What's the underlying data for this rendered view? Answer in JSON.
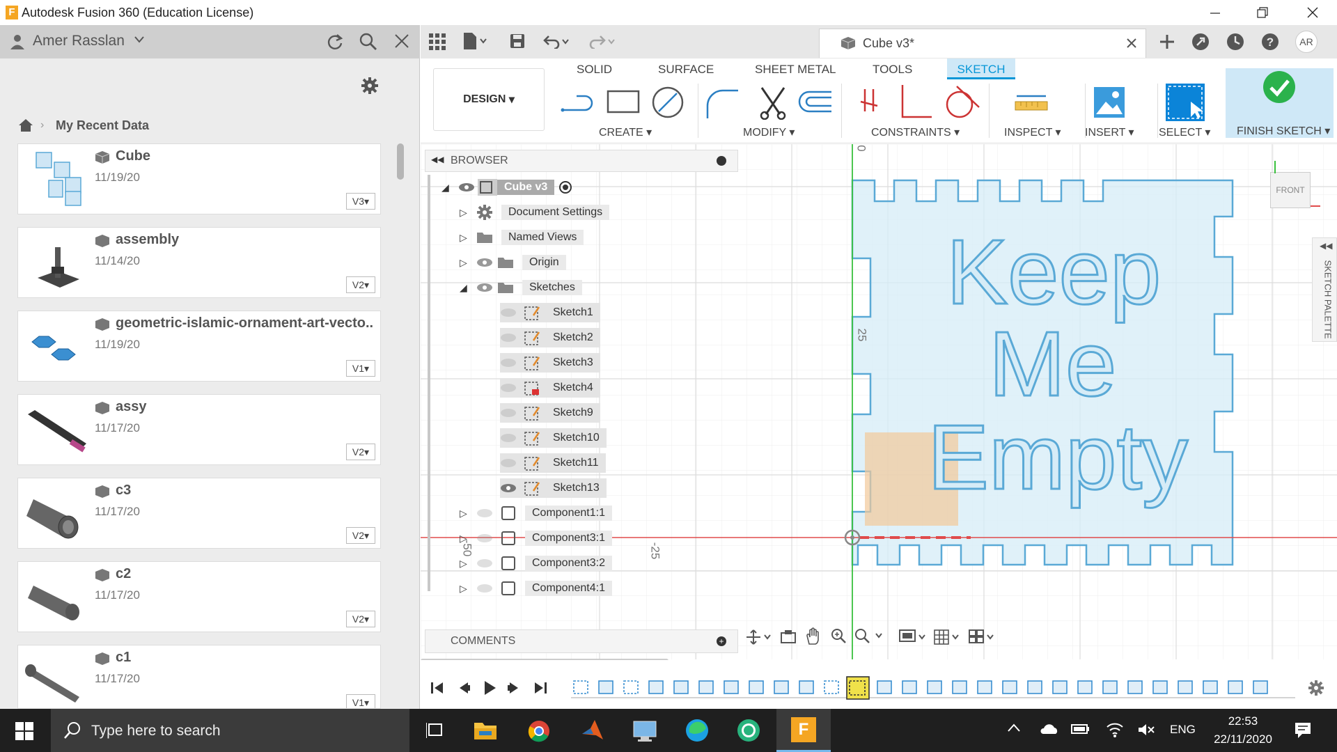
{
  "window": {
    "title": "Autodesk Fusion 360 (Education License)"
  },
  "data_panel": {
    "user": "Amer Rasslan",
    "breadcrumb": "My Recent Data",
    "items": [
      {
        "name": "Cube",
        "date": "11/19/20",
        "version": "V3"
      },
      {
        "name": "assembly",
        "date": "11/14/20",
        "version": "V2"
      },
      {
        "name": "geometric-islamic-ornament-art-vecto...",
        "date": "11/19/20",
        "version": "V1"
      },
      {
        "name": "assy",
        "date": "11/17/20",
        "version": "V2"
      },
      {
        "name": "c3",
        "date": "11/17/20",
        "version": "V2"
      },
      {
        "name": "c2",
        "date": "11/17/20",
        "version": "V2"
      },
      {
        "name": "c1",
        "date": "11/17/20",
        "version": "V1"
      }
    ]
  },
  "document": {
    "tab_title": "Cube v3*",
    "user_initials": "AR"
  },
  "toolbar": {
    "workspace": "DESIGN",
    "tabs": [
      "SOLID",
      "SURFACE",
      "SHEET METAL",
      "TOOLS",
      "SKETCH"
    ],
    "active_tab": "SKETCH",
    "groups": {
      "create": "CREATE",
      "modify": "MODIFY",
      "constraints": "CONSTRAINTS",
      "inspect": "INSPECT",
      "insert": "INSERT",
      "select": "SELECT",
      "finish": "FINISH SKETCH"
    }
  },
  "browser": {
    "title": "BROWSER",
    "root": "Cube v3",
    "nodes": [
      "Document Settings",
      "Named Views",
      "Origin",
      "Sketches"
    ],
    "sketches": [
      "Sketch1",
      "Sketch2",
      "Sketch3",
      "Sketch4",
      "Sketch9",
      "Sketch10",
      "Sketch11",
      "Sketch13"
    ],
    "components": [
      "Component1:1",
      "Component3:1",
      "Component3:2",
      "Component4:1"
    ]
  },
  "comments": {
    "title": "COMMENTS"
  },
  "canvas": {
    "text_lines": [
      "Keep",
      "Me",
      "Empty"
    ],
    "ruler_labels": [
      "0",
      "25",
      "-25",
      "-50"
    ],
    "viewcube": "FRONT",
    "sketch_palette": "SKETCH PALETTE"
  },
  "taskbar": {
    "search_placeholder": "Type here to search",
    "lang": "ENG",
    "time": "22:53",
    "date": "22/11/2020"
  },
  "colors": {
    "accent": "#0696d7",
    "sketch_fill": "#d6ecf7",
    "sketch_line": "#5aa9d6",
    "highlight": "#cfe8f7"
  }
}
